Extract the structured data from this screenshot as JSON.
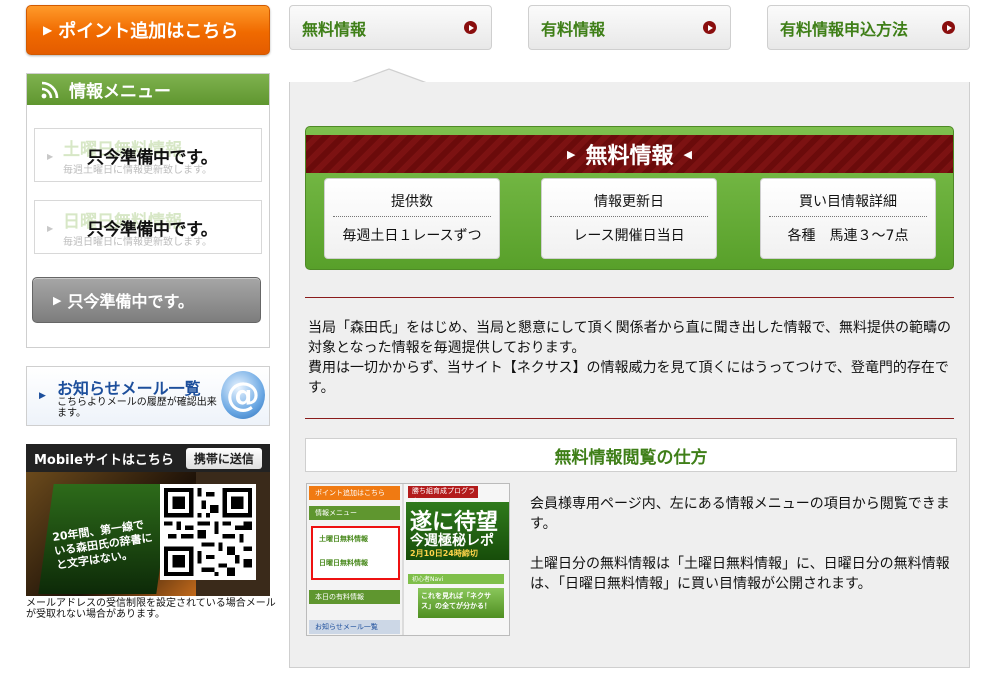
{
  "left": {
    "point_button": "ポイント追加はこちら",
    "menu": {
      "title": "情報メニュー",
      "items": [
        {
          "ghost_title": "土曜日無料情報",
          "ghost_sub": "毎週土曜日に情報更新致します。",
          "overlay": "只今準備中です。"
        },
        {
          "ghost_title": "日曜日無料情報",
          "ghost_sub": "毎週日曜日に情報更新致します。",
          "overlay": "只今準備中です。"
        }
      ],
      "gray_button": "只今準備中です。"
    },
    "mail_banner": {
      "title": "お知らせメール一覧",
      "sub": "こちらよりメールの履歴が確認出来ます。",
      "icon": "@"
    },
    "mobile": {
      "title": "Mobileサイトはこちら",
      "send": "携帯に送信",
      "screen_text": "20年間、第一線で\nいる森田氏の辞書に\nと文字はない。",
      "note": "メールアドレスの受信制限を設定されている場合メールが受取れない場合があります。"
    }
  },
  "tabs": [
    {
      "label": "無料情報"
    },
    {
      "label": "有料情報"
    },
    {
      "label": "有料情報申込方法"
    }
  ],
  "main": {
    "banner_title": "無料情報",
    "stats": [
      {
        "header": "提供数",
        "value": "毎週土日１レースずつ"
      },
      {
        "header": "情報更新日",
        "value": "レース開催日当日"
      },
      {
        "header": "買い目情報詳細",
        "value": "各種　馬連３～7点"
      }
    ],
    "description_1": "当局「森田氏」をはじめ、当局と懇意にして頂く関係者から直に聞き出した情報で、無料提供の範疇の対象となった情報を毎週提供しております。",
    "description_2": "費用は一切かからず、当サイト【ネクサス】の情報威力を見て頂くにはうってつけで、登竜門的存在です。",
    "howto_title": "無料情報閲覧の仕方",
    "howto_p1": "会員様専用ページ内、左にある情報メニューの項目から閲覧できます。",
    "howto_p2": "土曜日分の無料情報は「土曜日無料情報」に、日曜日分の無料情報は、「日曜日無料情報」に買い目情報が公開されます。",
    "screenshot": {
      "l_bar1": "ポイント追加はこちら",
      "l_bar2": "情報メニュー",
      "l_item1": "土曜日無料情報",
      "l_item2": "日曜日無料情報",
      "l_bar3": "本日の有料情報",
      "l_bar4": "お知らせメール一覧",
      "r_top": "勝ち組育成プログラム",
      "r_big": "遂に待望",
      "r_mid": "今週極秘レポ",
      "r_date": "2月10日24時締切",
      "r_nav": "初心者Navi",
      "r_cta": "これを見れば「ネクサス」の全てが分かる！"
    }
  }
}
